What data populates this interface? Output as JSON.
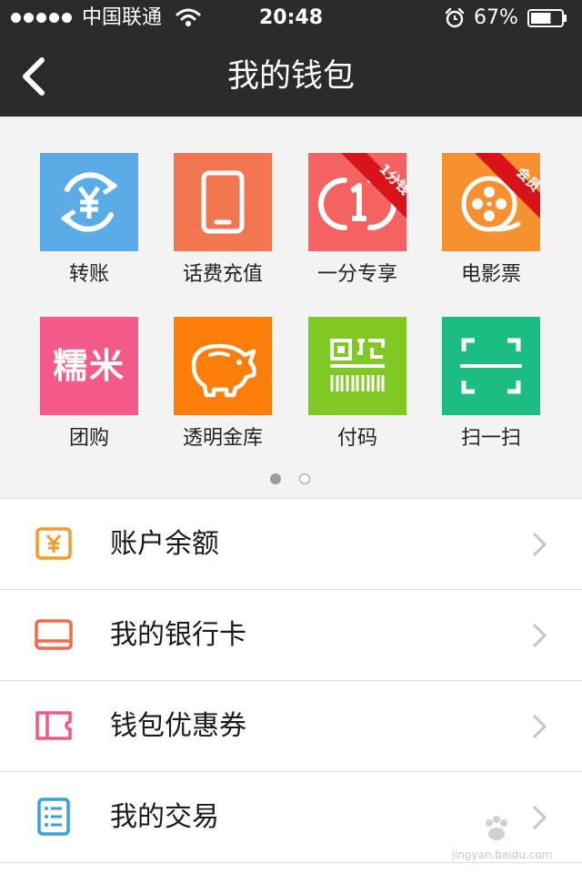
{
  "status_bar": {
    "carrier": "中国联通",
    "time": "20:48",
    "battery_percent": "67%",
    "battery_level": 0.67
  },
  "nav": {
    "title": "我的钱包"
  },
  "grid": {
    "items": [
      {
        "label": "转账",
        "icon": "transfer-yuan-icon",
        "color": "#5aabe6"
      },
      {
        "label": "话费充值",
        "icon": "phone-icon",
        "color": "#f27750"
      },
      {
        "label": "一分专享",
        "icon": "one-cent-icon",
        "color": "#f46262",
        "badge": "1分钱"
      },
      {
        "label": "电影票",
        "icon": "film-reel-icon",
        "color": "#f7902f",
        "badge": "会员"
      },
      {
        "label": "团购",
        "icon": "nuomi-logo-icon",
        "color": "#f35a88",
        "logo_text": "糯米"
      },
      {
        "label": "透明金库",
        "icon": "piggy-bank-icon",
        "color": "#fb7e0a"
      },
      {
        "label": "付码",
        "icon": "payment-code-icon",
        "color": "#80c925"
      },
      {
        "label": "扫一扫",
        "icon": "scan-icon",
        "color": "#1cbd82"
      }
    ],
    "pages_total": 2,
    "page_current": 1
  },
  "menu": {
    "items": [
      {
        "label": "账户余额",
        "icon": "balance-yuan-icon",
        "color": "#f39a2b"
      },
      {
        "label": "我的银行卡",
        "icon": "bank-card-icon",
        "color": "#f26a4a"
      },
      {
        "label": "钱包优惠券",
        "icon": "coupon-icon",
        "color": "#ee5a84"
      },
      {
        "label": "我的交易",
        "icon": "transactions-list-icon",
        "color": "#38a0d6"
      }
    ]
  },
  "watermark": {
    "text": "jingyan.baidu.com"
  }
}
